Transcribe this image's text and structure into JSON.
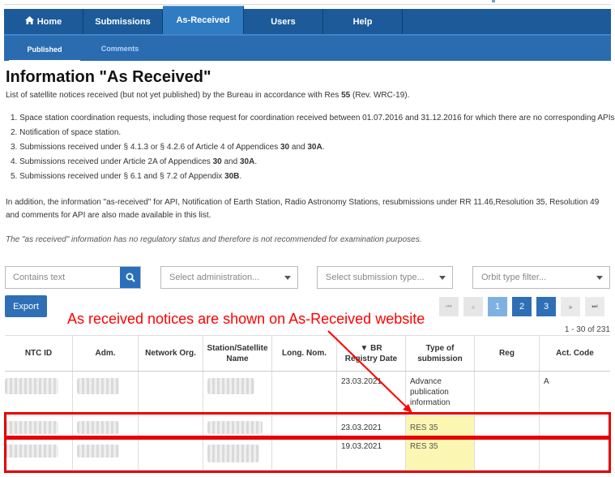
{
  "nav": {
    "tabs": [
      {
        "label": "Home",
        "icon": "home-icon"
      },
      {
        "label": "Submissions"
      },
      {
        "label": "As-Received"
      },
      {
        "label": "Users"
      },
      {
        "label": "Help"
      }
    ],
    "active_tab": "As-Received",
    "subtabs": [
      {
        "label": "Published"
      },
      {
        "label": "Comments"
      }
    ],
    "colors": {
      "nav_bg": "#1c5a9a",
      "active_tab": "#2f7cc3"
    }
  },
  "page": {
    "title": "Information \"As Received\"",
    "intro_before": "List of satellite notices received (but not yet published) by the Bureau in accordance with Res ",
    "intro_bold": "55",
    "intro_after": " (Rev. WRC-19).",
    "list": [
      {
        "text": "1. Space station coordination requests, including those request for coordination received between 01.07.2016 and 31.12.2016 for which there are no corresponding APIs."
      },
      {
        "text": "2. Notification of space station."
      },
      {
        "a": "3. Submissions received under § 4.1.3 or § 4.2.6 of Article 4 of Appendices ",
        "b1": "30",
        "m": " and ",
        "b2": "30A",
        "e": "."
      },
      {
        "a": "4. Submissions received under Article 2A of Appendices ",
        "b1": "30",
        "m": " and ",
        "b2": "30A",
        "e": "."
      },
      {
        "a": "5. Submissions received under § 6.1 and § 7.2 of Appendix ",
        "b1": "30B",
        "e": "."
      }
    ],
    "paragraph": "In addition, the information \"as-received\" for API, Notification of Earth Station, Radio Astronomy Stations, resubmissions under RR 11.46,Resolution 35, Resolution 49 and comments for API are also made available in this list.",
    "disclaimer": "The \"as received\" information has no regulatory status and therefore is not recommended for examination purposes."
  },
  "filters": {
    "search_placeholder": "Contains text",
    "administration": "Select administration...",
    "submission_type": "Select submission type...",
    "orbit_type": "Orbit type filter..."
  },
  "export_label": "Export",
  "pagination": {
    "first": "⏮",
    "prev": "«",
    "pages": [
      "1",
      "2",
      "3"
    ],
    "current": "1",
    "next": "»",
    "last": "⏭",
    "range": "1 - 30 of 231"
  },
  "annotation": "As received notices are shown on As-Received website",
  "table": {
    "columns": [
      "NTC ID",
      "Adm.",
      "Network Org.",
      "Station/Satellite Name",
      "Long. Nom.",
      "▼ BR Registry Date",
      "Type of submission",
      "Reg",
      "Act. Code"
    ],
    "rows": [
      {
        "date": "23.03.2021",
        "type": "Advance publication information",
        "reg": "",
        "act": "A"
      },
      {
        "date": "23.03.2021",
        "type": "RES 35",
        "reg": "",
        "act": ""
      },
      {
        "date": "19.03.2021",
        "type": "RES 35",
        "reg": "",
        "act": ""
      }
    ]
  }
}
